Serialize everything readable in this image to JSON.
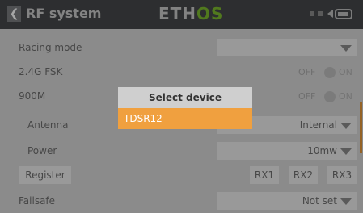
{
  "header": {
    "back_icon": "chevron-left-icon",
    "title": "RF system",
    "logo_part1": "ETH",
    "logo_part2": "OS",
    "status_text": "▢ ▢ ◀▓"
  },
  "rows": {
    "racing_mode": {
      "label": "Racing mode",
      "value": "---"
    },
    "fsk": {
      "label": "2.4G FSK",
      "off": "OFF",
      "on": "ON"
    },
    "m900": {
      "label": "900M",
      "off": "OFF",
      "on": "ON"
    },
    "antenna": {
      "label": "Antenna",
      "value": "Internal"
    },
    "power": {
      "label": "Power",
      "value": "10mw"
    },
    "register": {
      "label": "Register",
      "rx1": "RX1",
      "rx2": "RX2",
      "rx3": "RX3"
    },
    "failsafe": {
      "label": "Failsafe",
      "value": "Not set"
    }
  },
  "dialog": {
    "title": "Select device",
    "items": [
      "TDSR12"
    ]
  },
  "colors": {
    "accent": "#f0a03f",
    "topbar": "#46484a",
    "logo_green": "#7dbb2f"
  }
}
